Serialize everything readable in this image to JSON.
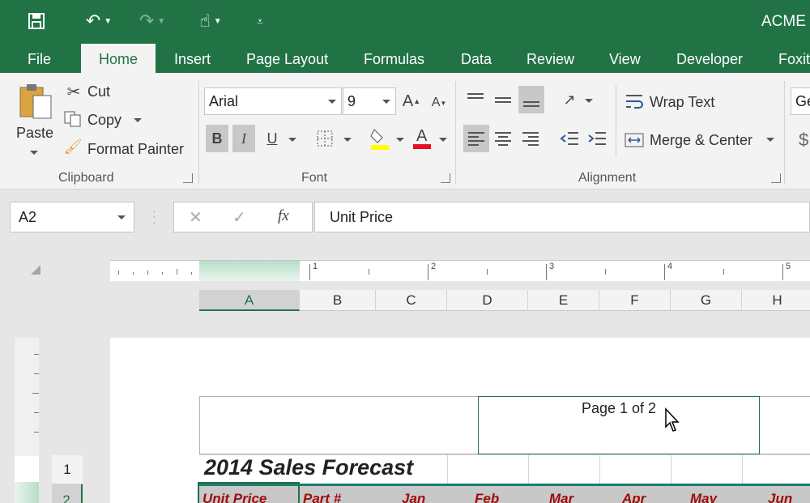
{
  "window": {
    "title": "ACME S"
  },
  "qat": {
    "save": "save-icon",
    "undo": "undo-icon",
    "redo": "redo-icon",
    "touch": "touch-mode-icon",
    "customize": "customize-qat-icon"
  },
  "tabs": [
    "File",
    "Home",
    "Insert",
    "Page Layout",
    "Formulas",
    "Data",
    "Review",
    "View",
    "Developer",
    "Foxit"
  ],
  "ribbon": {
    "clipboard": {
      "label": "Clipboard",
      "paste": "Paste",
      "cut": "Cut",
      "copy": "Copy",
      "format_painter": "Format Painter"
    },
    "font": {
      "label": "Font",
      "font_name": "Arial",
      "font_size": "9",
      "bold": "B",
      "italic": "I",
      "underline": "U",
      "fill_color": "#ffff00",
      "font_color": "#e81123"
    },
    "alignment": {
      "label": "Alignment",
      "wrap_text": "Wrap Text",
      "merge_center": "Merge & Center"
    },
    "number": {
      "format": "Ge",
      "currency": "$"
    }
  },
  "formula_bar": {
    "name_box": "A2",
    "formula": "Unit Price",
    "cancel": "✕",
    "enter": "✓",
    "fx": "fx"
  },
  "ruler": {
    "numbers": [
      "1",
      "2",
      "3",
      "4",
      "5"
    ]
  },
  "columns": [
    "A",
    "B",
    "C",
    "D",
    "E",
    "F",
    "G",
    "H"
  ],
  "rows": [
    "1",
    "2"
  ],
  "sheet": {
    "header_text": "Page 1 of 2",
    "title": "2014 Sales Forecast",
    "row2": [
      "Unit Price",
      "Part #",
      "Jan",
      "Feb",
      "Mar",
      "Apr",
      "May",
      "Jun"
    ]
  }
}
